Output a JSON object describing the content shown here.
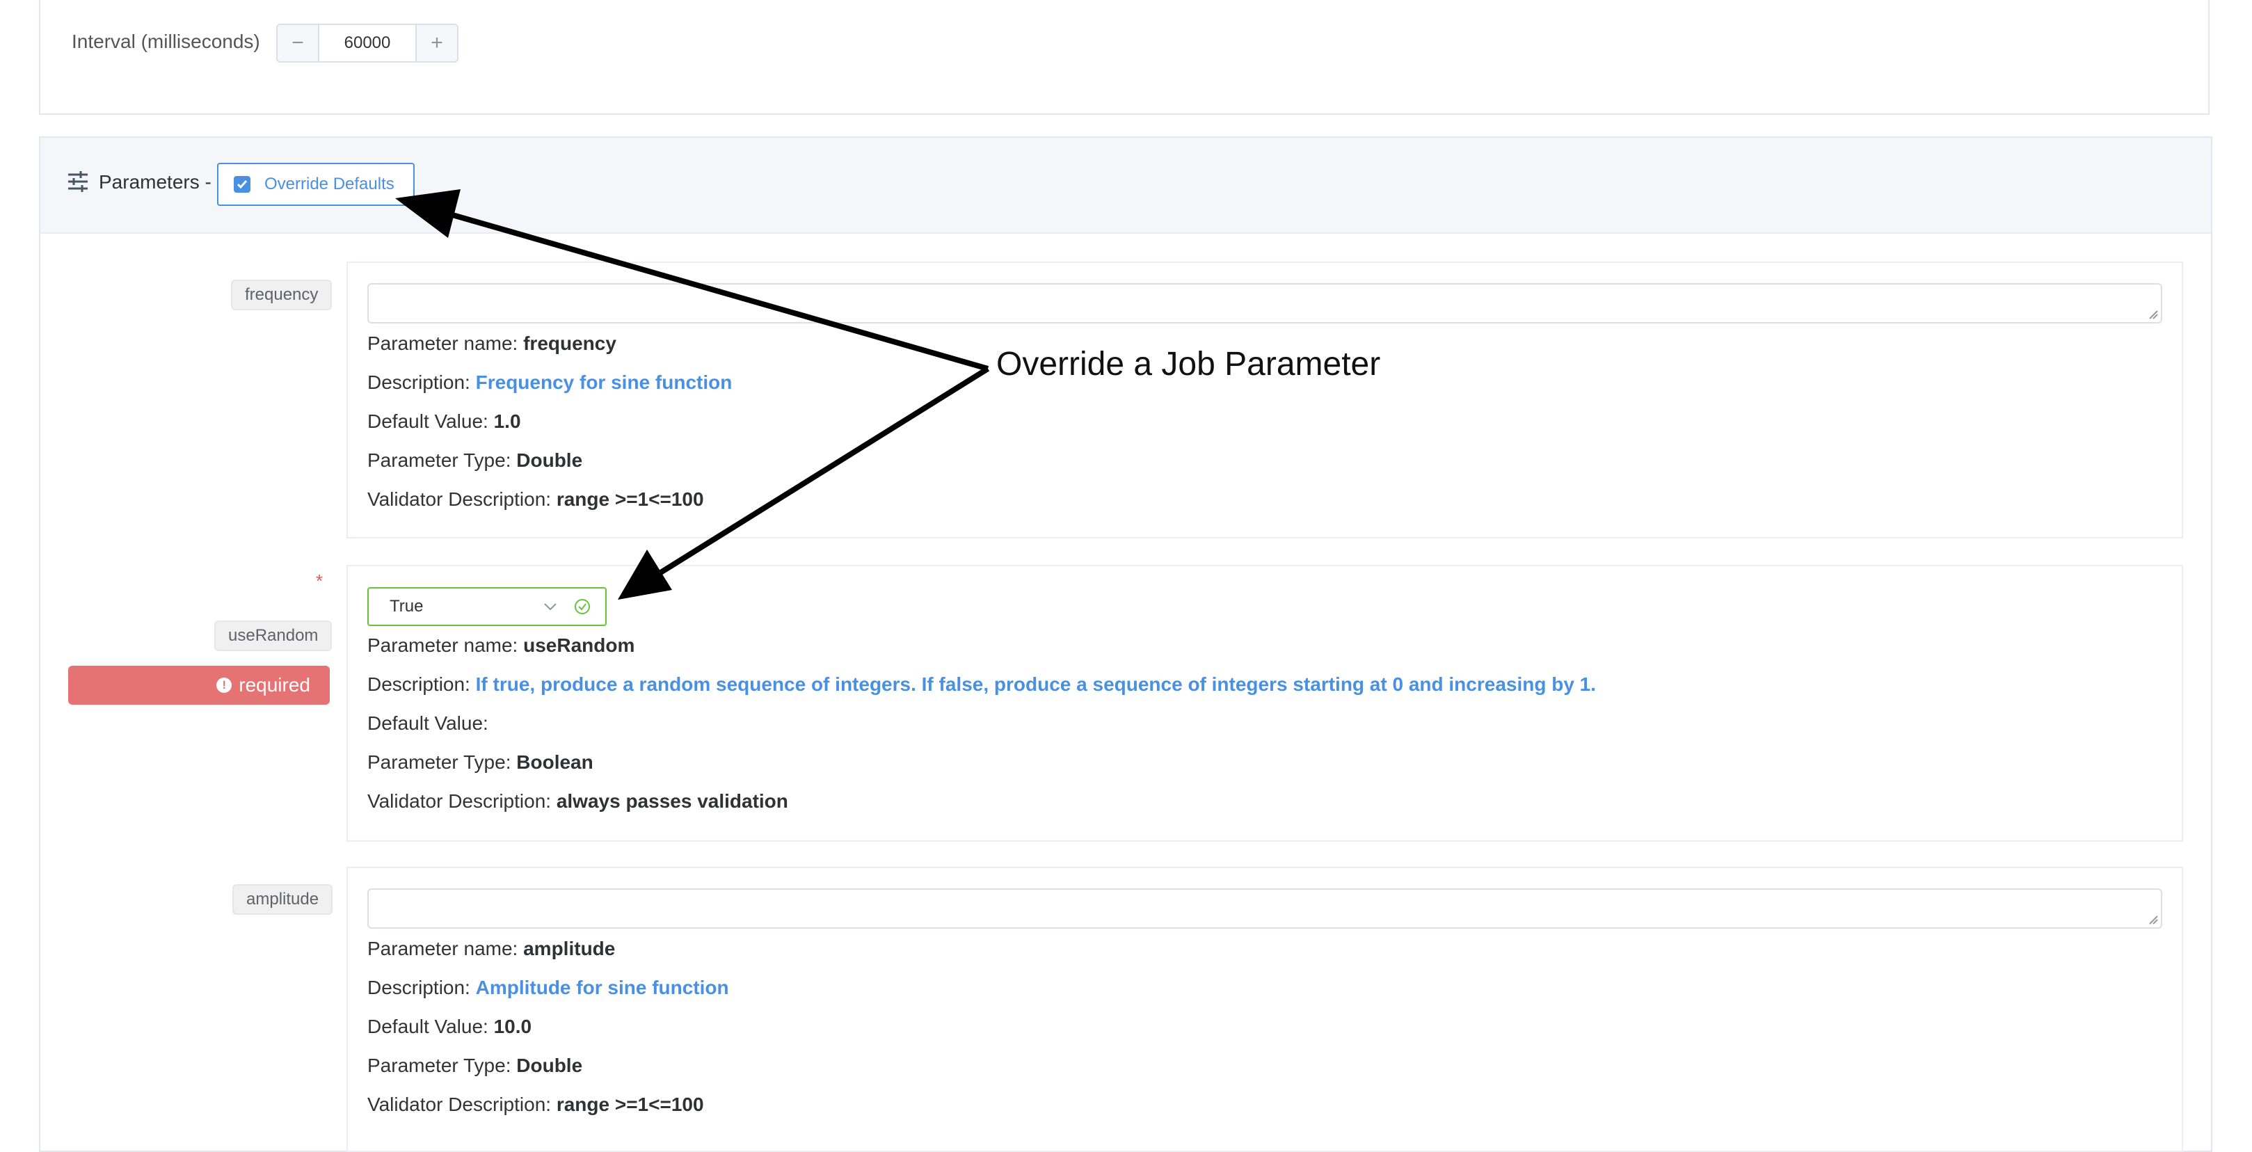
{
  "interval": {
    "label": "Interval (milliseconds)",
    "minus": "−",
    "value": "60000",
    "plus": "+"
  },
  "parameters": {
    "title": "Parameters -",
    "override_label": "Override Defaults",
    "override_checked": true,
    "items": [
      {
        "tag": "frequency",
        "name_prefix": "Parameter name: ",
        "name": "frequency",
        "desc_prefix": "Description: ",
        "description": "Frequency for sine function",
        "default_prefix": "Default Value: ",
        "default": "1.0",
        "type_prefix": "Parameter Type: ",
        "type": "Double",
        "validator_prefix": "Validator Description: ",
        "validator": "range >=1<=100"
      },
      {
        "required_star": "*",
        "tag": "useRandom",
        "required_label": "required",
        "select_value": "True",
        "name_prefix": "Parameter name: ",
        "name": "useRandom",
        "desc_prefix": "Description: ",
        "description": "If true, produce a random sequence of integers. If false, produce a sequence of integers starting at 0 and increasing by 1.",
        "default_prefix": "Default Value: ",
        "default": "",
        "type_prefix": "Parameter Type: ",
        "type": "Boolean",
        "validator_prefix": "Validator Description: ",
        "validator": "always passes validation"
      },
      {
        "tag": "amplitude",
        "name_prefix": "Parameter name: ",
        "name": "amplitude",
        "desc_prefix": "Description: ",
        "description": "Amplitude for sine function",
        "default_prefix": "Default Value: ",
        "default": "10.0",
        "type_prefix": "Parameter Type: ",
        "type": "Double",
        "validator_prefix": "Validator Description: ",
        "validator": "range >=1<=100"
      }
    ]
  },
  "annotation": {
    "text": "Override a Job Parameter"
  },
  "colors": {
    "accent": "#4a90e2",
    "success": "#67c23a",
    "error": "#e57373"
  }
}
